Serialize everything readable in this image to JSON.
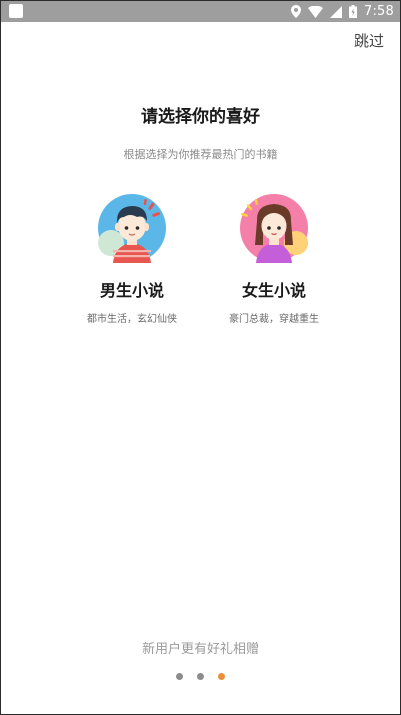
{
  "status_bar": {
    "time": "7:58",
    "icons": [
      "location-icon",
      "wifi-icon",
      "signal-icon",
      "battery-icon"
    ]
  },
  "header": {
    "skip_label": "跳过"
  },
  "main": {
    "title": "请选择你的喜好",
    "subtitle": "根据选择为你推荐最热门的书籍",
    "choices": [
      {
        "label": "男生小说",
        "description": "都市生活，玄幻仙侠",
        "avatar_color": "#5bb7e8"
      },
      {
        "label": "女生小说",
        "description": "豪门总裁，穿越重生",
        "avatar_color": "#f47fa8"
      }
    ]
  },
  "footer": {
    "promo": "新用户更有好礼相赠",
    "pager": {
      "total": 3,
      "active_index": 2
    },
    "dot_color": "#8c8c8c",
    "dot_active_color": "#e8903a"
  }
}
